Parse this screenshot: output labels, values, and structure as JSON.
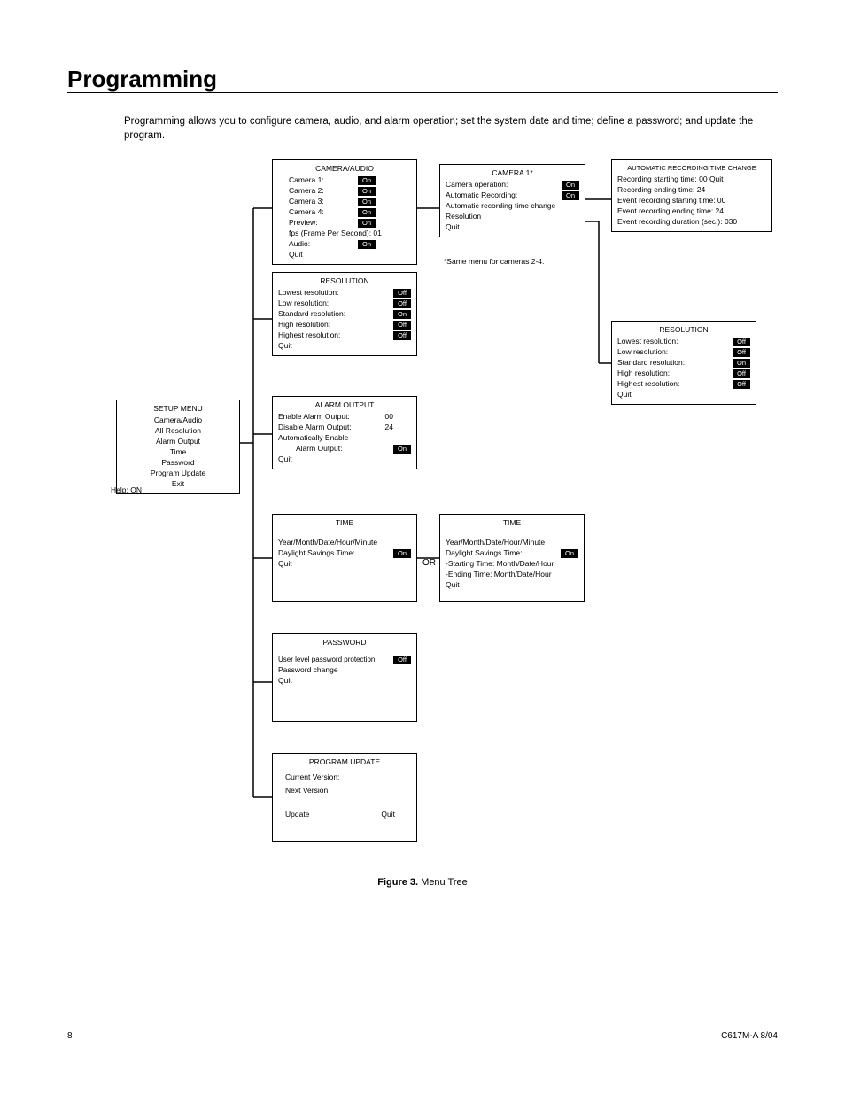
{
  "page": {
    "title": "Programming",
    "intro": "Programming allows you to configure camera, audio, and alarm operation; set the system date and time; define a password; and update the program.",
    "figure_label": "Figure 3.",
    "figure_text": "Menu Tree",
    "page_number": "8",
    "footer_id": "C617M-A 8/04"
  },
  "setup_menu": {
    "title": "SETUP MENU",
    "items": [
      "Camera/Audio",
      "All Resolution",
      "Alarm Output",
      "Time",
      "Password",
      "Program Update",
      "Exit"
    ],
    "help": "Help: ON"
  },
  "camera_audio": {
    "title": "CAMERA/AUDIO",
    "rows": [
      {
        "label": "Camera 1:",
        "value": "On"
      },
      {
        "label": "Camera 2:",
        "value": "On"
      },
      {
        "label": "Camera 3:",
        "value": "On"
      },
      {
        "label": "Camera 4:",
        "value": "On"
      },
      {
        "label": "Preview:",
        "value": "On"
      }
    ],
    "fps": "fps (Frame Per Second): 01",
    "audio": {
      "label": "Audio:",
      "value": "On"
    },
    "quit": "Quit"
  },
  "camera1": {
    "title": "CAMERA 1*",
    "operation": {
      "label": "Camera operation:",
      "value": "On"
    },
    "auto_recording": {
      "label": "Automatic Recording:",
      "value": "On"
    },
    "lines": [
      "Automatic recording time change",
      "Resolution",
      "Quit"
    ],
    "note": "*Same menu for cameras 2-4."
  },
  "auto_time_change": {
    "title": "AUTOMATIC RECORDING TIME CHANGE",
    "lines": [
      "Recording starting time: 00   Quit",
      "Recording ending time: 24",
      "Event recording starting time: 00",
      "Event recording ending time: 24",
      "Event recording duration (sec.): 030"
    ]
  },
  "resolution_all": {
    "title": "RESOLUTION",
    "rows": [
      {
        "label": "Lowest resolution:",
        "value": "Off"
      },
      {
        "label": "Low resolution:",
        "value": "Off"
      },
      {
        "label": "Standard resolution:",
        "value": "On"
      },
      {
        "label": "High resolution:",
        "value": "Off"
      },
      {
        "label": "Highest resolution:",
        "value": "Off"
      }
    ],
    "quit": "Quit"
  },
  "resolution_cam": {
    "title": "RESOLUTION",
    "rows": [
      {
        "label": "Lowest resolution:",
        "value": "Off"
      },
      {
        "label": "Low resolution:",
        "value": "Off"
      },
      {
        "label": "Standard resolution:",
        "value": "On"
      },
      {
        "label": "High resolution:",
        "value": "Off"
      },
      {
        "label": "Highest resolution:",
        "value": "Off"
      }
    ],
    "quit": "Quit"
  },
  "alarm_output": {
    "title": "ALARM OUTPUT",
    "rows": [
      {
        "label": "Enable Alarm Output:",
        "value": "00"
      },
      {
        "label": "Disable Alarm Output:",
        "value": "24"
      }
    ],
    "auto_enable": "Automatically Enable",
    "alarm_output_row": {
      "label": "Alarm Output:",
      "value": "On"
    },
    "quit": "Quit"
  },
  "time1": {
    "title": "TIME",
    "line1": "Year/Month/Date/Hour/Minute",
    "dst": {
      "label": "Daylight Savings Time:",
      "value": "On"
    },
    "quit": "Quit"
  },
  "time2": {
    "title": "TIME",
    "line1": "Year/Month/Date/Hour/Minute",
    "dst": {
      "label": "Daylight Savings Time:",
      "value": "On"
    },
    "start": "-Starting Time:  Month/Date/Hour",
    "end": "-Ending Time:  Month/Date/Hour",
    "quit": "Quit"
  },
  "or_label": "OR",
  "password": {
    "title": "PASSWORD",
    "row": {
      "label": "User level password protection:",
      "value": "Off"
    },
    "change": "Password change",
    "quit": "Quit"
  },
  "program_update": {
    "title": "PROGRAM UPDATE",
    "current": "Current Version:",
    "next": "Next Version:",
    "update": "Update",
    "quit": "Quit"
  }
}
